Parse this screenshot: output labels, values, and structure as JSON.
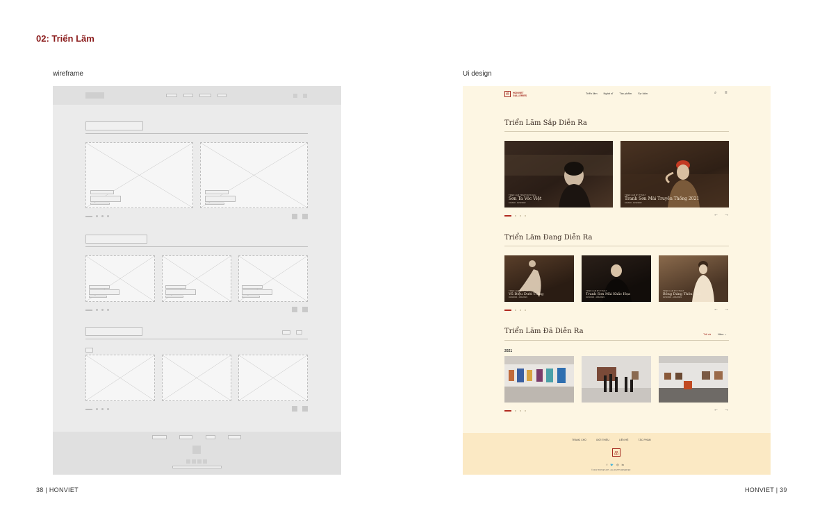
{
  "section_heading": "02: Triển Lãm",
  "panels": {
    "wireframe_label": "wireframe",
    "ui_label": "Ui design"
  },
  "footer": {
    "left": "38 |  HONVIET",
    "right": "HONVIET  | 39"
  },
  "ui": {
    "logo": {
      "mark": "品",
      "text": "HONVIET GALLERIES"
    },
    "nav": [
      "Triển lãm",
      "Nghệ sĩ",
      "Tác phẩm",
      "Sự kiện"
    ],
    "search_icon": "⌕",
    "menu_icon": "≡",
    "upcoming": {
      "title": "Triển Lãm Sắp Diễn Ra",
      "cards": [
        {
          "category": "TRIỂN LÃM TRANH SƠN DẦU",
          "title": "Sơn Ta Vóc Việt",
          "date": "1/1/2022 - 10/12/2022"
        },
        {
          "category": "TRIỂN LÃM MỸ THUẬT",
          "title": "Tranh Sơn Mài Truyền Thống 2021",
          "date": "1/1/2022 - 10/12/2022"
        }
      ]
    },
    "current": {
      "title": "Triển Lãm Đang Diễn Ra",
      "cards": [
        {
          "category": "TRIỂN LÃM MỸ THUẬT",
          "title": "Vũ Điệu Dưới Trăng",
          "date": "10/11/2021 - 10/12/2021"
        },
        {
          "category": "TRIỂN LÃM MỸ THUẬT",
          "title": "Tranh Sơn Mài Khắc Họa",
          "date": "10/11/2021 - 10/12/2021"
        },
        {
          "category": "TRIỂN LÃM MỸ THUẬT",
          "title": "Bóng Dáng Thôn Quê",
          "date": "10/11/2021 - 10/12/2021"
        }
      ]
    },
    "past": {
      "title": "Triển Lãm Đã Diễn Ra",
      "filter_all": "Tất cả",
      "filter_year": "Năm",
      "year": "2021"
    },
    "arrows": {
      "prev": "←",
      "next": "→"
    },
    "footer": {
      "nav": [
        "TRANG CHỦ",
        "GIỚI THIỆU",
        "LIÊN HỆ",
        "TÁC PHẨM"
      ],
      "logo_mark": "品",
      "social": [
        "f",
        "🐦",
        "◎",
        "in"
      ],
      "copyright": "© 2021 HONVIET ART - ALL RIGHTS RESERVED"
    },
    "colors": {
      "accent": "#a3281e",
      "background": "#fdf6e3",
      "footer": "#fbe9c4"
    }
  }
}
